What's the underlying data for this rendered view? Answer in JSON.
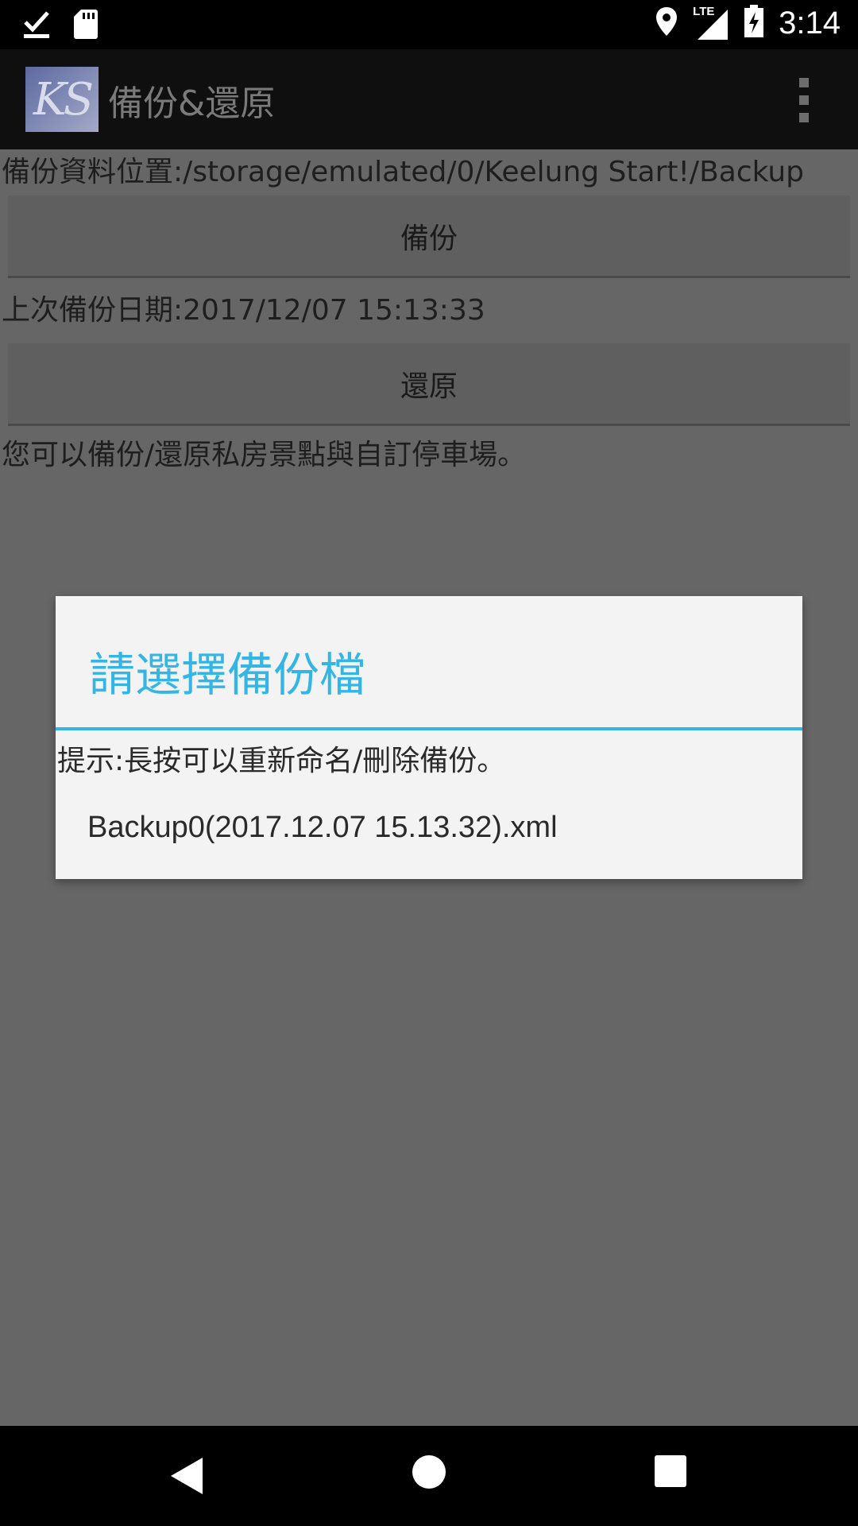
{
  "status_bar": {
    "time": "3:14",
    "network_label": "LTE",
    "icons": [
      "download-done-icon",
      "sd-card-icon",
      "location-icon",
      "signal-icon",
      "battery-charging-icon"
    ]
  },
  "app_bar": {
    "logo_text": "KS",
    "title": "備份&還原",
    "overflow_icon": "more-vert-icon"
  },
  "content": {
    "backup_location": "備份資料位置:/storage/emulated/0/Keelung Start!/Backup",
    "backup_button": "備份",
    "last_backup": "上次備份日期:2017/12/07 15:13:33",
    "restore_button": "還原",
    "description": "您可以備份/還原私房景點與自訂停車場。"
  },
  "dialog": {
    "title": "請選擇備份檔",
    "hint": "提示:長按可以重新命名/刪除備份。",
    "items": [
      "Backup0(2017.12.07 15.13.32).xml"
    ]
  },
  "nav_bar": {
    "icons": [
      "back-icon",
      "home-icon",
      "recent-apps-icon"
    ]
  },
  "colors": {
    "accent": "#33b5e5",
    "scrim": "#666666",
    "dialog_bg": "#f3f3f3"
  }
}
